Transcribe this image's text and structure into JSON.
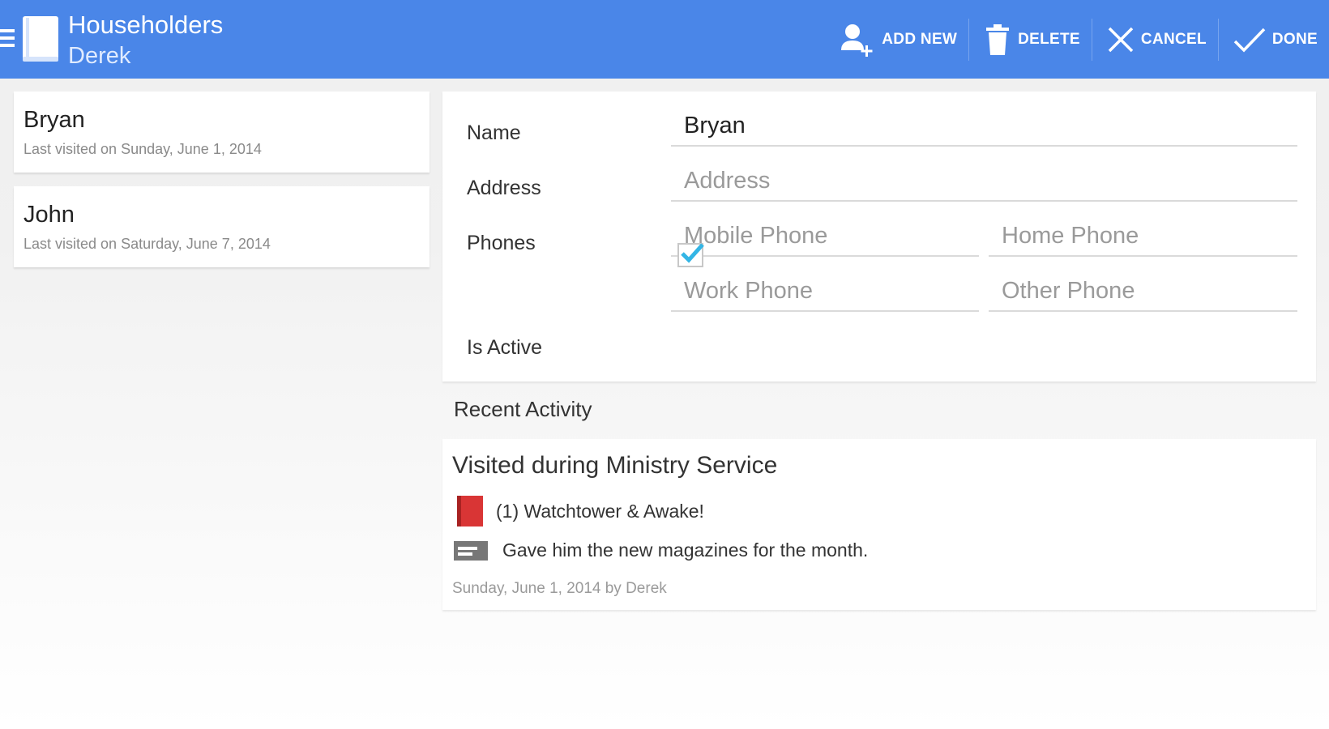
{
  "app": {
    "title": "Householders",
    "subtitle": "Derek"
  },
  "actions": {
    "add_new": "ADD NEW",
    "delete": "DELETE",
    "cancel": "CANCEL",
    "done": "DONE"
  },
  "householders": [
    {
      "name": "Bryan",
      "last_visited": "Last visited on Sunday, June 1, 2014"
    },
    {
      "name": "John",
      "last_visited": "Last visited on Saturday, June 7, 2014"
    }
  ],
  "form": {
    "name_label": "Name",
    "name_value": "Bryan",
    "address_label": "Address",
    "address_placeholder": "Address",
    "phones_label": "Phones",
    "mobile_placeholder": "Mobile Phone",
    "home_placeholder": "Home Phone",
    "work_placeholder": "Work Phone",
    "other_placeholder": "Other Phone",
    "active_label": "Is Active",
    "active_checked": true
  },
  "recent": {
    "heading": "Recent Activity",
    "activity": {
      "title": "Visited during Ministry Service",
      "placement": "(1) Watchtower & Awake!",
      "note": "Gave him the new magazines for the month.",
      "meta": "Sunday, June 1, 2014 by Derek"
    }
  },
  "colors": {
    "action_bar": "#4a86e8",
    "checkbox_tick": "#33b5e5",
    "book_icon": "#d93535"
  }
}
